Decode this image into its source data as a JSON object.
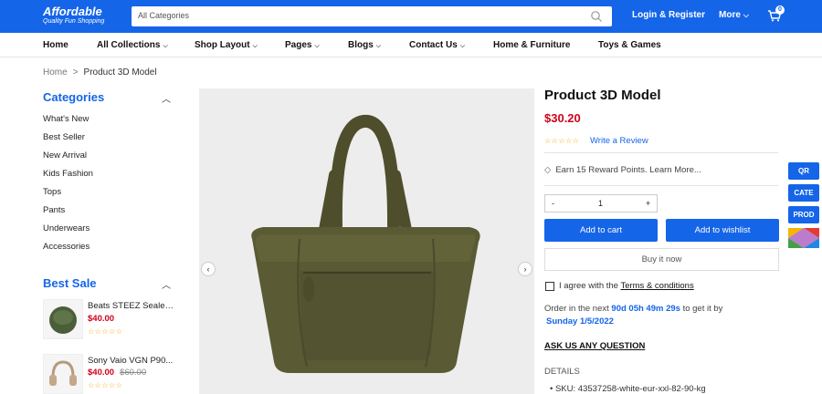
{
  "header": {
    "logo_title": "Affordable",
    "logo_tagline": "Quality Fun Shopping",
    "search_placeholder": "All Categories",
    "login_label": "Login & Register",
    "more_label": "More",
    "cart_count": "0"
  },
  "nav": {
    "items": [
      {
        "label": "Home",
        "has_dropdown": false
      },
      {
        "label": "All Collections",
        "has_dropdown": true
      },
      {
        "label": "Shop Layout",
        "has_dropdown": true
      },
      {
        "label": "Pages",
        "has_dropdown": true
      },
      {
        "label": "Blogs",
        "has_dropdown": true
      },
      {
        "label": "Contact Us",
        "has_dropdown": true
      },
      {
        "label": "Home & Furniture",
        "has_dropdown": false
      },
      {
        "label": "Toys & Games",
        "has_dropdown": false
      }
    ]
  },
  "breadcrumb": {
    "home": "Home",
    "separator": ">",
    "current": "Product 3D Model"
  },
  "sidebar": {
    "categories_title": "Categories",
    "categories": [
      "What's New",
      "Best Seller",
      "New Arrival",
      "Kids Fashion",
      "Tops",
      "Pants",
      "Underwears",
      "Accessories"
    ],
    "best_sale_title": "Best Sale",
    "best_sale": [
      {
        "name": "Beats STEEZ Sealed ...",
        "price": "$40.00",
        "old_price": "",
        "rating": 0
      },
      {
        "name": "Sony Vaio VGN P90...",
        "price": "$40.00",
        "old_price": "$60.00",
        "rating": 0
      }
    ]
  },
  "product": {
    "title": "Product 3D Model",
    "price": "$30.20",
    "rating": 0,
    "write_review": "Write a Review",
    "reward_text": "Earn 15 Reward Points.",
    "learn_more": "Learn More...",
    "quantity": "1",
    "minus": "-",
    "plus": "+",
    "add_to_cart": "Add to cart",
    "add_to_wishlist": "Add to wishlist",
    "buy_now": "Buy it now",
    "agree_text": "I agree with the",
    "terms_label": "Terms & conditions",
    "order_prefix": "Order in the next",
    "countdown": "90d 05h 49m 29s",
    "order_suffix": "to get it by",
    "delivery_date": "Sunday 1/5/2022",
    "ask_question": "ASK US ANY QUESTION",
    "details_label": "DETAILS",
    "sku_text": "SKU: 43537258-white-eur-xxl-82-90-kg"
  },
  "gallery": {
    "prev_icon": "‹",
    "next_icon": "›"
  },
  "side_buttons": [
    "QR",
    "CATE",
    "PROD"
  ],
  "colors": {
    "brand": "#1565e8",
    "price": "#d0021b",
    "stars": "#f0a500",
    "bag": "#5a5a34"
  }
}
